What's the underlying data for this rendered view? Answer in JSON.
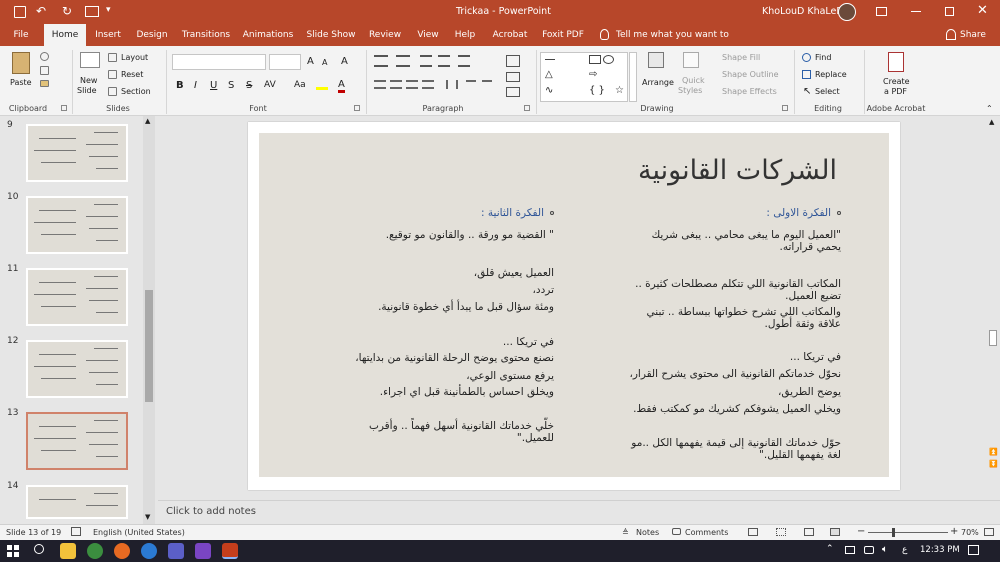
{
  "window": {
    "title": "Trickaa  -  PowerPoint",
    "user": "KhoLouD KhaLeD"
  },
  "tabs": [
    "File",
    "Home",
    "Insert",
    "Design",
    "Transitions",
    "Animations",
    "Slide Show",
    "Review",
    "View",
    "Help",
    "Acrobat",
    "Foxit PDF"
  ],
  "active_tab": "Home",
  "tell_me": "Tell me what you want to do",
  "share": "Share",
  "ribbon": {
    "clipboard": {
      "paste": "Paste",
      "label": "Clipboard"
    },
    "slides": {
      "new_slide_1": "New",
      "new_slide_2": "Slide",
      "layout": "Layout",
      "reset": "Reset",
      "section": "Section",
      "label": "Slides"
    },
    "font": {
      "label": "Font",
      "bold": "B",
      "italic": "I",
      "underline": "U",
      "strike": "S",
      "shadow": "S",
      "spacing": "AV",
      "case": "Aa",
      "grow": "A",
      "shrink": "A",
      "clear": "A",
      "color": "A"
    },
    "paragraph": {
      "label": "Paragraph"
    },
    "drawing": {
      "arrange": "Arrange",
      "quick_styles_1": "Quick",
      "quick_styles_2": "Styles",
      "shape_fill": "Shape Fill",
      "shape_outline": "Shape Outline",
      "shape_effects": "Shape Effects",
      "label": "Drawing"
    },
    "editing": {
      "find": "Find",
      "replace": "Replace",
      "select": "Select",
      "label": "Editing"
    },
    "acrobat": {
      "create_1": "Create",
      "create_2": "a PDF",
      "label": "Adobe Acrobat"
    }
  },
  "thumbnails": [
    {
      "num": "9",
      "selected": false
    },
    {
      "num": "10",
      "selected": false
    },
    {
      "num": "11",
      "selected": false
    },
    {
      "num": "12",
      "selected": false
    },
    {
      "num": "13",
      "selected": true
    },
    {
      "num": "14",
      "selected": false
    }
  ],
  "slide": {
    "title": "الشركات القانونية",
    "right_column": {
      "heading": "الفكرة الاولى :",
      "lines": [
        "\"العميل اليوم ما يبغى محامي .. يبغى شريك",
        "يحمي قراراته.",
        "المكاتب القانونية اللي تتكلم مصطلحات كثيرة ..",
        "تضيع العميل.",
        "والمكاتب اللي تشرح خطواتها ببساطة .. تبني",
        "علاقة وثقة أطول.",
        "في تريكا ...",
        "نحوّل خدماتكم القانونية الى محتوى يشرح القرار،",
        "يوضح الطريق،",
        "ويخلي العميل يشوفكم كشريك مو كمكتب فقط.",
        "حوّل خدماتك القانونية إلى قيمة يفهمها الكل ..مو",
        "لغة يفهمها القليل.\""
      ]
    },
    "left_column": {
      "heading": "الفكرة الثانية :",
      "lines": [
        "\" القضية مو ورقة .. والقانون مو توقيع.",
        "العميل يعيش قلق،",
        "تردد،",
        "ومئة سؤال قبل ما يبدأ أي خطوة قانونية.",
        "في تريكا ...",
        "نصنع محتوى يوضح الرحلة القانونية من بدايتها،",
        "يرفع مستوى الوعي،",
        "ويخلق احساس بالطمأنينة قبل اي اجراء.",
        "خلّي خدماتك القانونية أسهل فهماً .. وأقرب",
        "للعميل.\""
      ]
    }
  },
  "notes_placeholder": "Click to add notes",
  "status": {
    "slide_count": "Slide 13 of 19",
    "language": "English (United States)",
    "notes": "Notes",
    "comments": "Comments",
    "zoom": "70%"
  },
  "taskbar": {
    "time": "12:33 PM",
    "lang": "ع"
  }
}
